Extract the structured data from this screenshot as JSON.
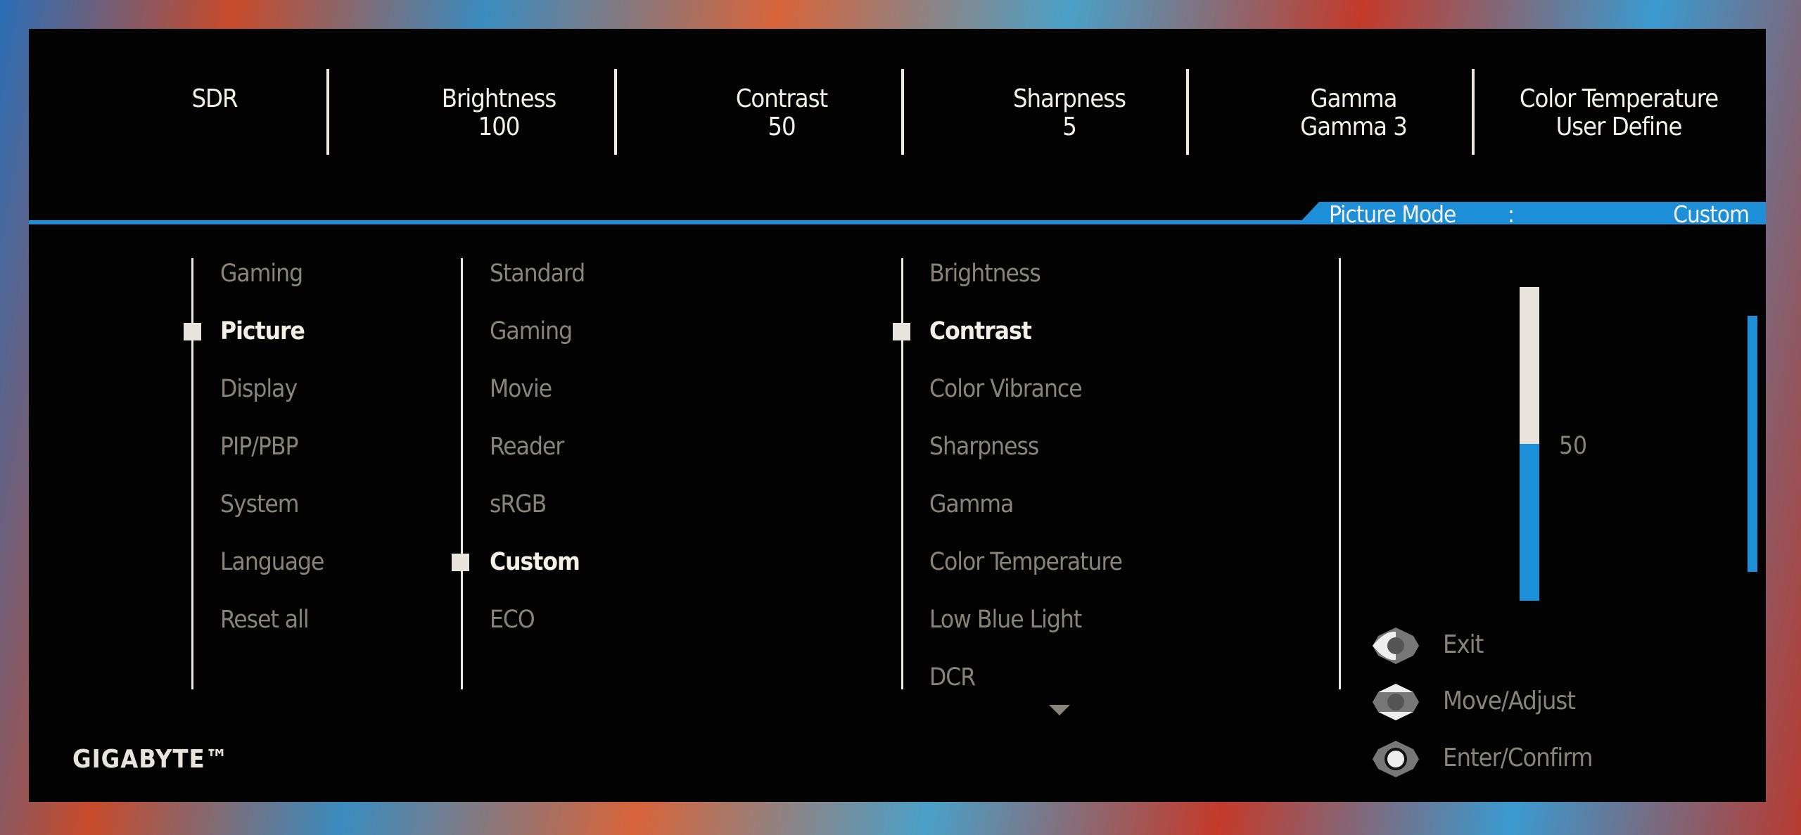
{
  "header": [
    {
      "label": "SDR",
      "value": ""
    },
    {
      "label": "Brightness",
      "value": "100"
    },
    {
      "label": "Contrast",
      "value": "50"
    },
    {
      "label": "Sharpness",
      "value": "5"
    },
    {
      "label": "Gamma",
      "value": "Gamma 3"
    },
    {
      "label": "Color Temperature",
      "value": "User Define"
    }
  ],
  "mode_tab": {
    "label": "Picture Mode",
    "sep": ":",
    "value": "Custom"
  },
  "menu": [
    "Gaming",
    "Picture",
    "Display",
    "PIP/PBP",
    "System",
    "Language",
    "Reset all"
  ],
  "picture_modes": [
    "Standard",
    "Gaming",
    "Movie",
    "Reader",
    "sRGB",
    "Custom",
    "ECO"
  ],
  "settings": [
    "Brightness",
    "Contrast",
    "Color Vibrance",
    "Sharpness",
    "Gamma",
    "Color Temperature",
    "Low Blue Light",
    "DCR"
  ],
  "slider": {
    "value": "50",
    "fraction": 0.5
  },
  "legend": [
    "Exit",
    "Move/Adjust",
    "Enter/Confirm"
  ],
  "brand": "GIGABYTE™",
  "colors": {
    "accent": "#1d8fd8",
    "text": "#f4f0e6",
    "dim": "#8a8478"
  }
}
